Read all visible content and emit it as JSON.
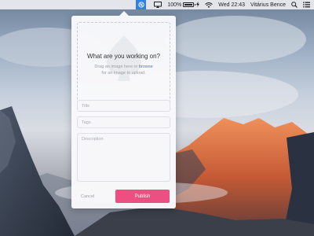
{
  "menubar": {
    "app_icon": "dribbble-icon",
    "battery_percent": "100%",
    "battery_level": 1.0,
    "clock": "Wed 22:43",
    "user": "Vitárius Bence",
    "icons": [
      "airplay-icon",
      "battery-icon",
      "bolt-icon",
      "wifi-icon",
      "search-icon",
      "list-icon"
    ]
  },
  "dropzone": {
    "title": "What are you working on?",
    "line1_before": "Drag an image here or ",
    "link": "browse",
    "line2": "for an image to upload."
  },
  "form": {
    "title_placeholder": "Title",
    "tags_placeholder": "Tags",
    "description_placeholder": "Description"
  },
  "actions": {
    "cancel": "Cancel",
    "publish": "Publish"
  },
  "colors": {
    "accent": "#ee4f83",
    "link": "#3a7fd8",
    "menubar_app_bg": "#2f80e8"
  }
}
